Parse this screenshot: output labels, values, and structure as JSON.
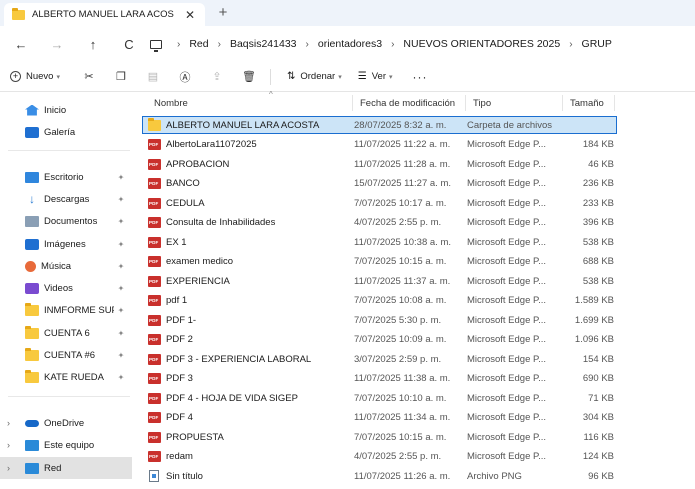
{
  "tab": {
    "title": "ALBERTO MANUEL LARA ACOS",
    "close": "✕",
    "new": "+"
  },
  "address": {
    "back": "←",
    "forward": "→",
    "up": "↑",
    "refresh": "C",
    "crumbs": [
      "Red",
      "Baqsis241433",
      "orientadores3",
      "NUEVOS ORIENTADORES 2025",
      "GRUP"
    ],
    "separator": "›"
  },
  "toolbar": {
    "new_label": "Nuevo",
    "sort_label": "Ordenar",
    "view_label": "Ver",
    "more": "···",
    "icons": [
      "scissors-icon",
      "copy-icon",
      "paste-icon",
      "rename-icon",
      "share-icon",
      "delete-icon"
    ]
  },
  "sidebar": {
    "items": [
      {
        "label": "Inicio",
        "icon": "home-icon"
      },
      {
        "label": "Galería",
        "icon": "gallery-icon"
      },
      {
        "label": "Escritorio",
        "icon": "desktop-icon",
        "pinned": true
      },
      {
        "label": "Descargas",
        "icon": "download-icon",
        "pinned": true
      },
      {
        "label": "Documentos",
        "icon": "document-icon",
        "pinned": true
      },
      {
        "label": "Imágenes",
        "icon": "pictures-icon",
        "pinned": true
      },
      {
        "label": "Música",
        "icon": "music-icon",
        "pinned": true
      },
      {
        "label": "Videos",
        "icon": "videos-icon",
        "pinned": true
      },
      {
        "label": "INMFORME SUP",
        "icon": "folder-icon",
        "pinned": true
      },
      {
        "label": "CUENTA 6",
        "icon": "folder-icon",
        "pinned": true
      },
      {
        "label": "CUENTA #6",
        "icon": "folder-icon",
        "pinned": true
      },
      {
        "label": "KATE RUEDA",
        "icon": "folder-icon",
        "pinned": true
      },
      {
        "label": "OneDrive",
        "icon": "cloud-icon"
      },
      {
        "label": "Este equipo",
        "icon": "computer-icon"
      },
      {
        "label": "Red",
        "icon": "network-icon",
        "selected": true
      }
    ],
    "pin_glyph": "✦",
    "expander": "›"
  },
  "columns": {
    "name": "Nombre",
    "date": "Fecha de modificación",
    "type": "Tipo",
    "size": "Tamaño"
  },
  "files": [
    {
      "name": "ALBERTO MANUEL LARA ACOSTA",
      "date": "28/07/2025 8:32 a. m.",
      "type": "Carpeta de archivos",
      "size": "",
      "kind": "folder",
      "selected": true
    },
    {
      "name": "AlbertoLara11072025",
      "date": "11/07/2025 11:22 a. m.",
      "type": "Microsoft Edge P...",
      "size": "184 KB",
      "kind": "pdf"
    },
    {
      "name": "APROBACION",
      "date": "11/07/2025 11:28 a. m.",
      "type": "Microsoft Edge P...",
      "size": "46 KB",
      "kind": "pdf"
    },
    {
      "name": "BANCO",
      "date": "15/07/2025 11:27 a. m.",
      "type": "Microsoft Edge P...",
      "size": "236 KB",
      "kind": "pdf"
    },
    {
      "name": "CEDULA",
      "date": "7/07/2025 10:17 a. m.",
      "type": "Microsoft Edge P...",
      "size": "233 KB",
      "kind": "pdf"
    },
    {
      "name": "Consulta de Inhabilidades",
      "date": "4/07/2025 2:55 p. m.",
      "type": "Microsoft Edge P...",
      "size": "396 KB",
      "kind": "pdf"
    },
    {
      "name": "EX 1",
      "date": "11/07/2025 10:38 a. m.",
      "type": "Microsoft Edge P...",
      "size": "538 KB",
      "kind": "pdf"
    },
    {
      "name": "examen medico",
      "date": "7/07/2025 10:15 a. m.",
      "type": "Microsoft Edge P...",
      "size": "688 KB",
      "kind": "pdf"
    },
    {
      "name": "EXPERIENCIA",
      "date": "11/07/2025 11:37 a. m.",
      "type": "Microsoft Edge P...",
      "size": "538 KB",
      "kind": "pdf"
    },
    {
      "name": "pdf 1",
      "date": "7/07/2025 10:08 a. m.",
      "type": "Microsoft Edge P...",
      "size": "1.589 KB",
      "kind": "pdf"
    },
    {
      "name": "PDF 1-",
      "date": "7/07/2025 5:30 p. m.",
      "type": "Microsoft Edge P...",
      "size": "1.699 KB",
      "kind": "pdf"
    },
    {
      "name": "PDF 2",
      "date": "7/07/2025 10:09 a. m.",
      "type": "Microsoft Edge P...",
      "size": "1.096 KB",
      "kind": "pdf"
    },
    {
      "name": "PDF 3 - EXPERIENCIA LABORAL",
      "date": "3/07/2025 2:59 p. m.",
      "type": "Microsoft Edge P...",
      "size": "154 KB",
      "kind": "pdf"
    },
    {
      "name": "PDF 3",
      "date": "11/07/2025 11:38 a. m.",
      "type": "Microsoft Edge P...",
      "size": "690 KB",
      "kind": "pdf"
    },
    {
      "name": "PDF 4 - HOJA DE VIDA SIGEP",
      "date": "7/07/2025 10:10 a. m.",
      "type": "Microsoft Edge P...",
      "size": "71 KB",
      "kind": "pdf"
    },
    {
      "name": "PDF 4",
      "date": "11/07/2025 11:34 a. m.",
      "type": "Microsoft Edge P...",
      "size": "304 KB",
      "kind": "pdf"
    },
    {
      "name": "PROPUESTA",
      "date": "7/07/2025 10:15 a. m.",
      "type": "Microsoft Edge P...",
      "size": "116 KB",
      "kind": "pdf"
    },
    {
      "name": "redam",
      "date": "4/07/2025 2:55 p. m.",
      "type": "Microsoft Edge P...",
      "size": "124 KB",
      "kind": "pdf"
    },
    {
      "name": "Sin título",
      "date": "11/07/2025 11:26 a. m.",
      "type": "Archivo PNG",
      "size": "96 KB",
      "kind": "png"
    }
  ],
  "colors": {
    "selection_bg": "#cce4f7",
    "selection_border": "#1a6ed0",
    "folder": "#f8c93e",
    "pdf": "#c9302c",
    "tabbar": "#eef3fa"
  }
}
